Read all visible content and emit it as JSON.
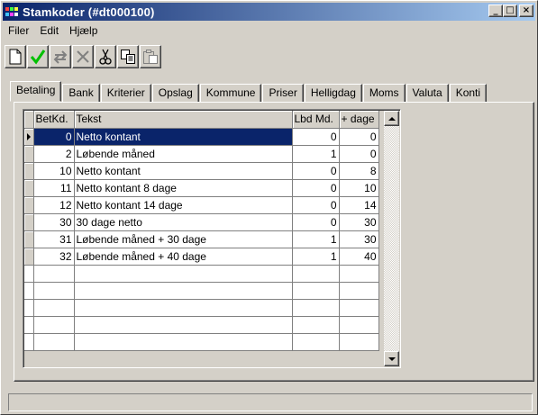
{
  "window": {
    "title": "Stamkoder (#dt000100)",
    "controls": [
      "_",
      "□",
      "×"
    ]
  },
  "menu": [
    "Filer",
    "Edit",
    "Hjælp"
  ],
  "toolbar": [
    {
      "name": "new-document-icon"
    },
    {
      "name": "checkmark-icon",
      "color": "#00c000"
    },
    {
      "name": "undo-arrows-icon"
    },
    {
      "name": "delete-x-icon"
    },
    {
      "name": "scissors-icon"
    },
    {
      "name": "copy-icon"
    },
    {
      "name": "paste-icon"
    }
  ],
  "tabs": [
    "Betaling",
    "Bank",
    "Kriterier",
    "Opslag",
    "Kommune",
    "Priser",
    "Helligdag",
    "Moms",
    "Valuta",
    "Konti"
  ],
  "active_tab": "Betaling",
  "grid": {
    "columns": [
      "BetKd.",
      "Tekst",
      "Lbd Md.",
      "+ dage"
    ],
    "rows": [
      {
        "betkd": "0",
        "tekst": "Netto kontant",
        "lbd": "0",
        "dage": "0"
      },
      {
        "betkd": "2",
        "tekst": "Løbende måned",
        "lbd": "1",
        "dage": "0"
      },
      {
        "betkd": "10",
        "tekst": "Netto kontant",
        "lbd": "0",
        "dage": "8"
      },
      {
        "betkd": "11",
        "tekst": "Netto kontant 8 dage",
        "lbd": "0",
        "dage": "10"
      },
      {
        "betkd": "12",
        "tekst": "Netto kontant 14 dage",
        "lbd": "0",
        "dage": "14"
      },
      {
        "betkd": "30",
        "tekst": "30 dage netto",
        "lbd": "0",
        "dage": "30"
      },
      {
        "betkd": "31",
        "tekst": "Løbende måned + 30 dage",
        "lbd": "1",
        "dage": "30"
      },
      {
        "betkd": "32",
        "tekst": "Løbende måned + 40 dage",
        "lbd": "1",
        "dage": "40"
      }
    ],
    "selected_row": 0,
    "empty_rows": 5
  },
  "colors": {
    "title_gradient_start": "#0a246a",
    "title_gradient_end": "#a6caf0",
    "selection": "#0a246a",
    "face": "#d4d0c8"
  },
  "statusbar": {
    "text": ""
  }
}
